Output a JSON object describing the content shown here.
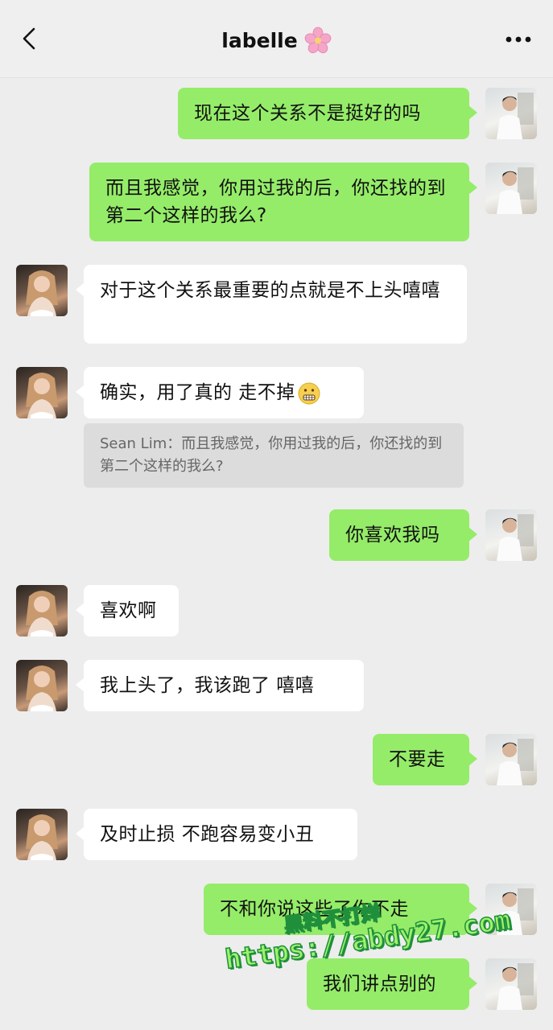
{
  "header": {
    "title": "labelle",
    "icons": {
      "back": "chevron-left-icon",
      "title_emoji": "cherry-blossom-icon",
      "more": "more-horizontal-icon"
    }
  },
  "messages": [
    {
      "side": "me",
      "text": "现在这个关系不是挺好的吗"
    },
    {
      "side": "me",
      "text": "而且我感觉，你用过我的后，你还找的到 第二个这样的我么?"
    },
    {
      "side": "her",
      "text": "对于这个关系最重要的点就是不上头嘻嘻"
    },
    {
      "side": "her",
      "text": "确实，用了真的 走不掉",
      "emoji": "grimacing-face-icon",
      "quote": "Sean Lim：而且我感觉，你用过我的后，你还找的到 第二个这样的我么?"
    },
    {
      "side": "me",
      "text": "你喜欢我吗"
    },
    {
      "side": "her",
      "text": "喜欢啊"
    },
    {
      "side": "her",
      "text": "我上头了，我该跑了 嘻嘻"
    },
    {
      "side": "me",
      "text": "不要走"
    },
    {
      "side": "her",
      "text": "及时止损 不跑容易变小丑"
    },
    {
      "side": "me",
      "text": "不和你说这些了你不走"
    },
    {
      "side": "me",
      "text": "我们讲点别的"
    }
  ],
  "watermark": {
    "line1": "黑料不打烊",
    "line2": "https://abdy27.com"
  },
  "colors": {
    "background": "#ededed",
    "sent_bubble": "#95ec69",
    "received_bubble": "#ffffff",
    "quote_bg": "#dcdcdc",
    "watermark_fill": "#9ff26a",
    "watermark_stroke": "#1f8f3c"
  }
}
